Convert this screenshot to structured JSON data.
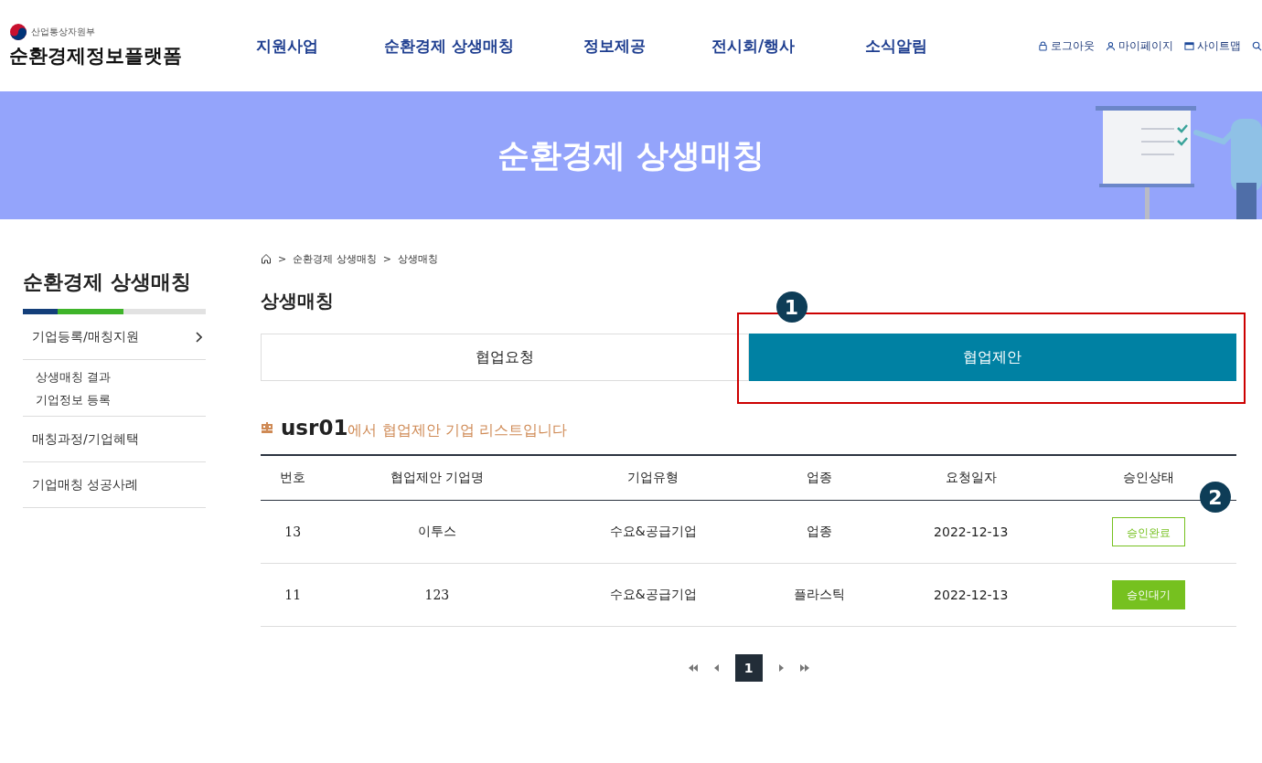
{
  "header": {
    "ministry": "산업통상자원부",
    "site_title": "순환경제정보플랫폼",
    "nav": [
      "지원사업",
      "순환경제 상생매칭",
      "정보제공",
      "전시회/행사",
      "소식알림"
    ],
    "utility": [
      {
        "kind": "lock",
        "label": "로그아웃"
      },
      {
        "kind": "person",
        "label": "마이페이지"
      },
      {
        "kind": "sitemap",
        "label": "사이트맵"
      },
      {
        "kind": "search"
      }
    ]
  },
  "banner": {
    "title": "순환경제 상생매칭"
  },
  "sidebar": {
    "title": "순환경제 상생매칭",
    "items": [
      {
        "label": "기업등록/매칭지원",
        "children": [
          {
            "label": "상생매칭 결과"
          },
          {
            "label": "기업정보 등록"
          }
        ]
      },
      {
        "label": "매칭과정/기업혜택"
      },
      {
        "label": "기업매칭 성공사례"
      }
    ]
  },
  "breadcrumb": [
    {
      "separator": ">",
      "label": "순환경제 상생매칭"
    },
    {
      "separator": ">",
      "label": "상생매칭"
    }
  ],
  "page_title": "상생매칭",
  "tabs": [
    {
      "label": "협업요청",
      "selected": false
    },
    {
      "label": "협업제안",
      "selected": true,
      "annotation": "1"
    }
  ],
  "list_heading": {
    "user": "usr01",
    "text": "에서 협업제안 기업 리스트입니다"
  },
  "table": {
    "columns": [
      {
        "label": "번호"
      },
      {
        "label": "협업제안 기업명"
      },
      {
        "label": "기업유형"
      },
      {
        "label": "업종"
      },
      {
        "label": "요청일자"
      },
      {
        "label": "승인상태",
        "annotation": "2"
      }
    ],
    "rows": [
      {
        "cells": [
          "13",
          "이투스",
          "수요&공급기업",
          "업종",
          "2022-12-13"
        ],
        "status": {
          "kind": "done",
          "label": "승인완료"
        }
      },
      {
        "cells": [
          "11",
          "123",
          "수요&공급기업",
          "플라스틱",
          "2022-12-13"
        ],
        "status": {
          "kind": "waiting",
          "label": "승인대기"
        }
      }
    ]
  },
  "pagination": {
    "pages": [
      {
        "label": "1",
        "selected": true
      }
    ]
  }
}
